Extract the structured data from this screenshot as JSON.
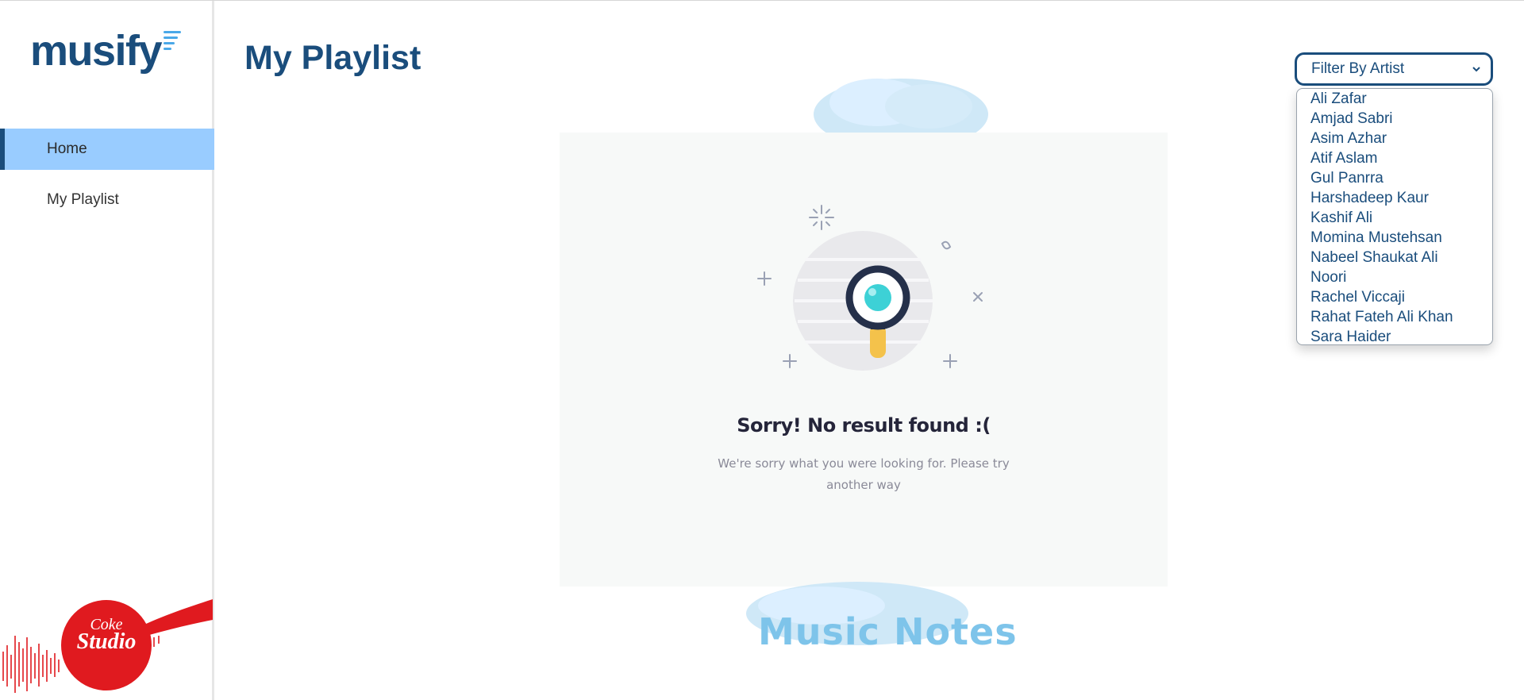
{
  "app": {
    "logo_text": "musify",
    "accent": "#1a4d7c",
    "highlight": "#99ccff"
  },
  "sidebar": {
    "items": [
      {
        "label": "Home",
        "active": true
      },
      {
        "label": "My Playlist",
        "active": false
      }
    ],
    "promo": {
      "brand_line1": "Coke",
      "brand_line2": "Studio",
      "brand_color": "#e01a1f"
    }
  },
  "main": {
    "title": "My Playlist",
    "filter": {
      "selected": "Filter By Artist",
      "options": [
        "Ali Zafar",
        "Amjad Sabri",
        "Asim Azhar",
        "Atif Aslam",
        "Gul Panrra",
        "Harshadeep Kaur",
        "Kashif Ali",
        "Momina Mustehsan",
        "Nabeel Shaukat Ali",
        "Noori",
        "Rachel Viccaji",
        "Rahat Fateh Ali Khan",
        "Sara Haider"
      ]
    },
    "empty_state": {
      "title": "Sorry! No result found :(",
      "subtitle": "We're sorry what you were looking for. Please try another way",
      "icon": "magnifier-icon"
    },
    "footer_art": "Music Notes"
  }
}
